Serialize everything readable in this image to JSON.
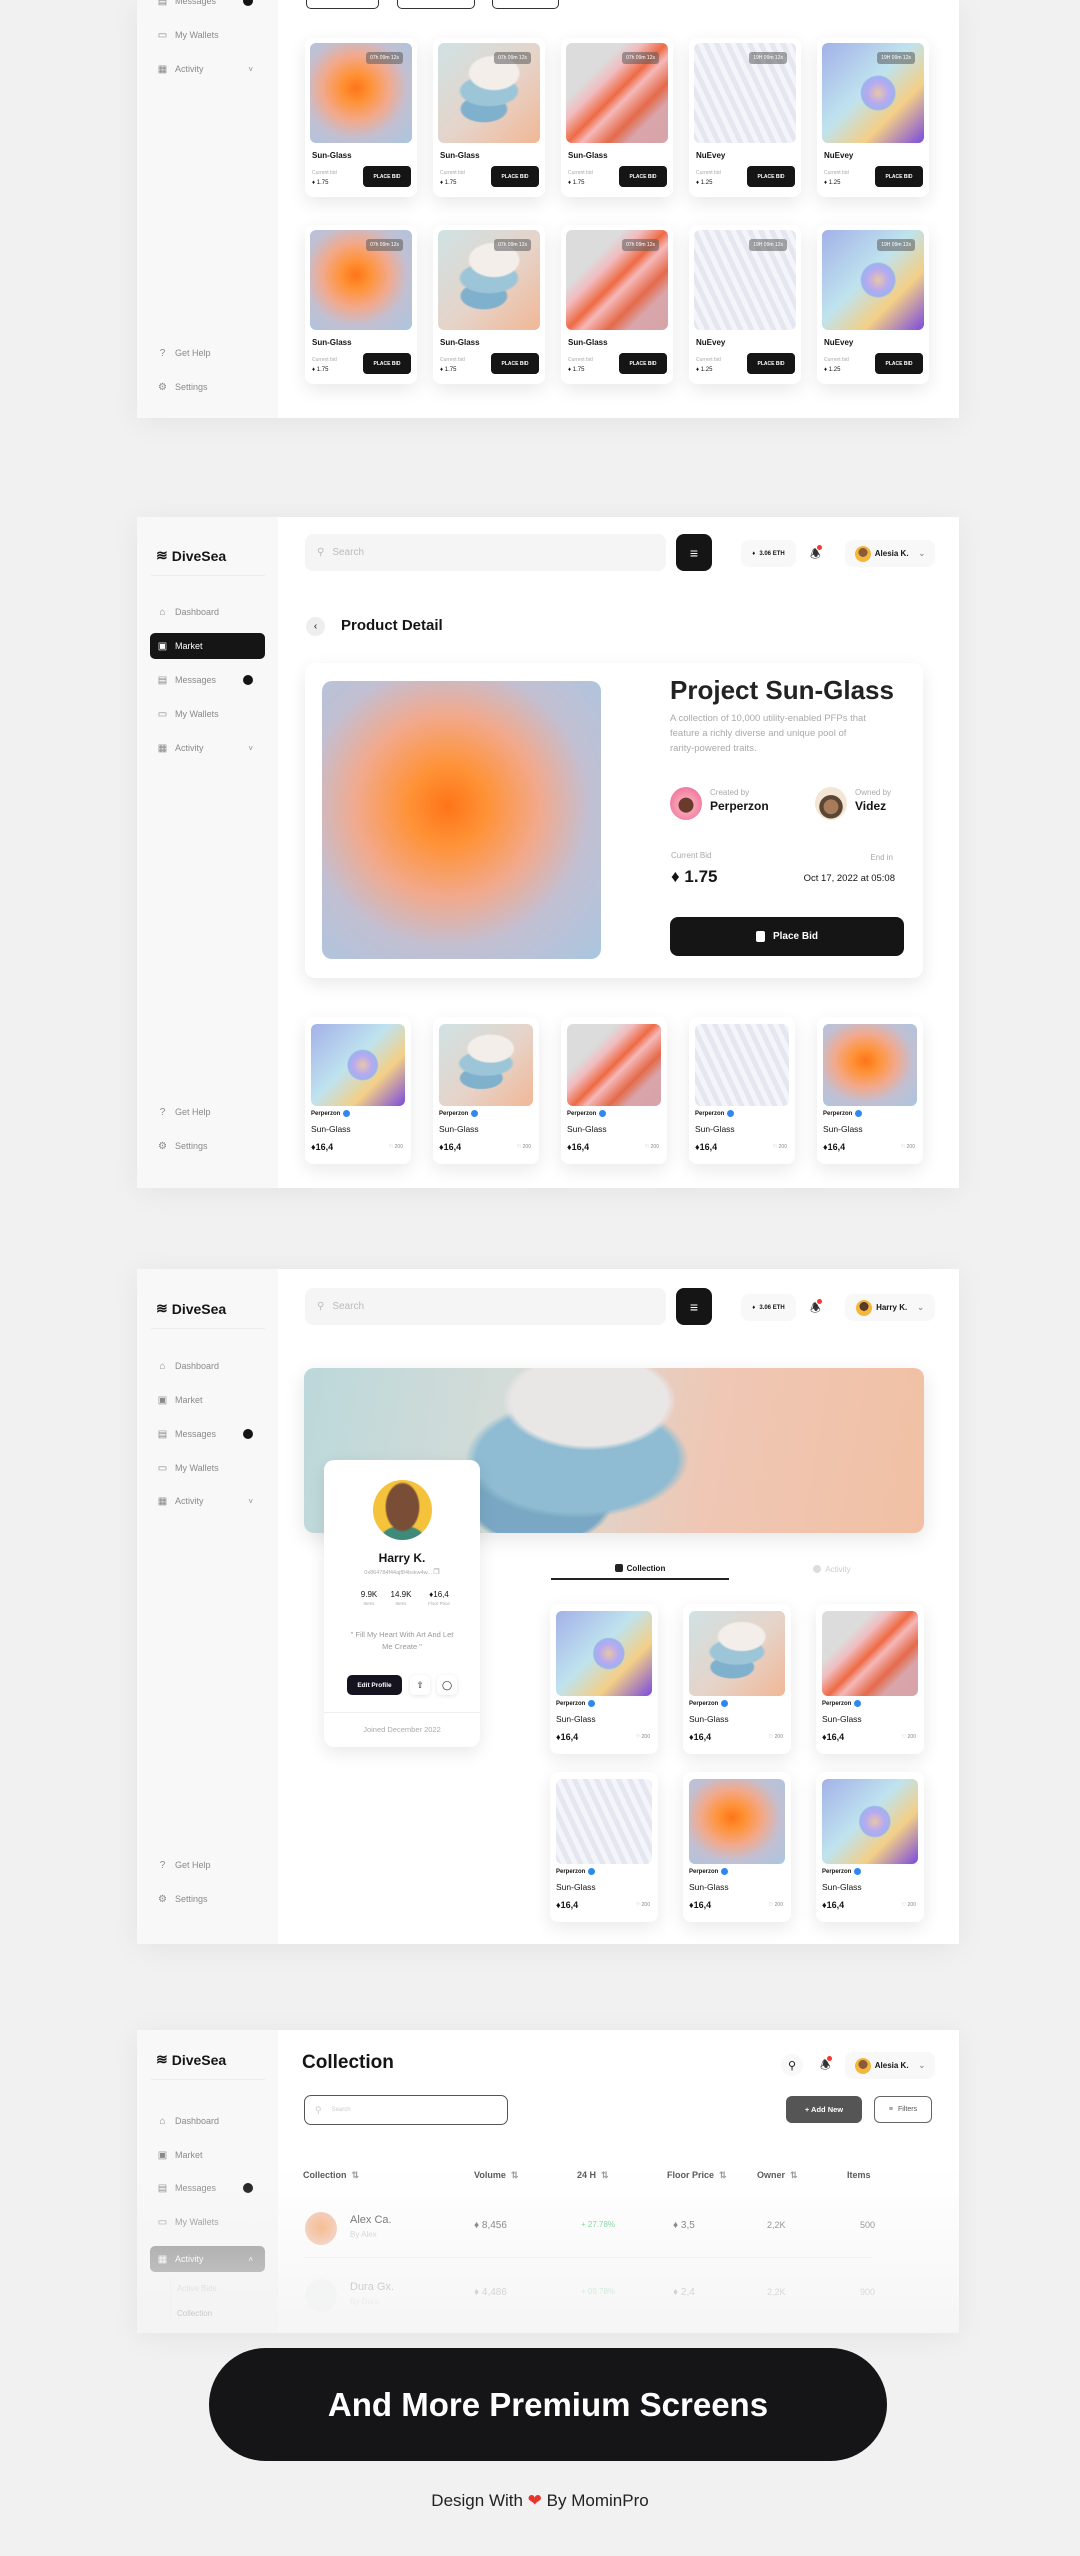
{
  "brand": "DiveSea",
  "colors": {
    "accent": "#151515",
    "verified": "#2e88f0",
    "positive": "#5fd08a",
    "notification": "#ff3333"
  },
  "panel1": {
    "sidebar": [
      {
        "label": "Messages",
        "icon": "messages-icon",
        "badge": true
      },
      {
        "label": "My Wallets",
        "icon": "wallet-icon"
      },
      {
        "label": "Activity",
        "icon": "activity-icon",
        "chevron": true
      }
    ],
    "sidebar_footer": [
      {
        "label": "Get Help",
        "icon": "help-icon"
      },
      {
        "label": "Settings",
        "icon": "settings-icon"
      }
    ],
    "cards": [
      {
        "timer": "07h 09m 12s",
        "name": "Sun-Glass",
        "bid_label": "Current bid",
        "bid": "1.75",
        "button": "PLACE BID",
        "art": "orange"
      },
      {
        "timer": "07h 09m 12s",
        "name": "Sun-Glass",
        "bid_label": "Current bid",
        "bid": "1.75",
        "button": "PLACE BID",
        "art": "disc"
      },
      {
        "timer": "07h 09m 12s",
        "name": "Sun-Glass",
        "bid_label": "Current bid",
        "bid": "1.75",
        "button": "PLACE BID",
        "art": "red"
      },
      {
        "timer": "19H 09m 12s",
        "name": "NuEvey",
        "bid_label": "Current bid",
        "bid": "1.25",
        "button": "PLACE BID",
        "art": "white"
      },
      {
        "timer": "19H 09m 12s",
        "name": "NuEvey",
        "bid_label": "Current bid",
        "bid": "1.25",
        "button": "PLACE BID",
        "art": "planet"
      },
      {
        "timer": "07h 09m 12s",
        "name": "Sun-Glass",
        "bid_label": "Current bid",
        "bid": "1.75",
        "button": "PLACE BID",
        "art": "orange"
      },
      {
        "timer": "07h 09m 12s",
        "name": "Sun-Glass",
        "bid_label": "Current bid",
        "bid": "1.75",
        "button": "PLACE BID",
        "art": "disc"
      },
      {
        "timer": "07h 09m 12s",
        "name": "Sun-Glass",
        "bid_label": "Current bid",
        "bid": "1.75",
        "button": "PLACE BID",
        "art": "red"
      },
      {
        "timer": "19H 09m 12s",
        "name": "NuEvey",
        "bid_label": "Current bid",
        "bid": "1.25",
        "button": "PLACE BID",
        "art": "white"
      },
      {
        "timer": "19H 09m 12s",
        "name": "NuEvey",
        "bid_label": "Current bid",
        "bid": "1.25",
        "button": "PLACE BID",
        "art": "planet"
      }
    ]
  },
  "panel2": {
    "search_placeholder": "Search",
    "eth_balance": "3.06 ETH",
    "user": "Alesia K.",
    "sidebar": [
      {
        "label": "Dashboard",
        "icon": "home-icon"
      },
      {
        "label": "Market",
        "icon": "market-icon",
        "active": true
      },
      {
        "label": "Messages",
        "icon": "messages-icon",
        "badge": true
      },
      {
        "label": "My Wallets",
        "icon": "wallet-icon"
      },
      {
        "label": "Activity",
        "icon": "activity-icon",
        "chevron": true
      }
    ],
    "sidebar_footer": [
      {
        "label": "Get Help",
        "icon": "help-icon"
      },
      {
        "label": "Settings",
        "icon": "settings-icon"
      }
    ],
    "page_title": "Product Detail",
    "product": {
      "title": "Project Sun-Glass",
      "description": "A collection of 10,000 utility-enabled PFPs that feature a richly diverse and unique pool of rarity-powered traits.",
      "created_label": "Created by",
      "creator": "Perperzon",
      "owned_label": "Owned by",
      "owner": "Videz",
      "bid_label": "Current Bid",
      "bid": "1.75",
      "end_label": "End in",
      "end_date": "Oct 17, 2022 at 05:08",
      "button": "Place Bid"
    },
    "cards": [
      {
        "author": "Perperzon",
        "name": "Sun-Glass",
        "price": "16,4",
        "likes": "200",
        "art": "planet"
      },
      {
        "author": "Perperzon",
        "name": "Sun-Glass",
        "price": "16,4",
        "likes": "200",
        "art": "disc"
      },
      {
        "author": "Perperzon",
        "name": "Sun-Glass",
        "price": "16,4",
        "likes": "200",
        "art": "red"
      },
      {
        "author": "Perperzon",
        "name": "Sun-Glass",
        "price": "16,4",
        "likes": "200",
        "art": "white"
      },
      {
        "author": "Perperzon",
        "name": "Sun-Glass",
        "price": "16,4",
        "likes": "200",
        "art": "orange"
      }
    ]
  },
  "panel3": {
    "search_placeholder": "Search",
    "eth_balance": "3.06 ETH",
    "user": "Harry K.",
    "sidebar": [
      {
        "label": "Dashboard",
        "icon": "home-icon"
      },
      {
        "label": "Market",
        "icon": "market-icon"
      },
      {
        "label": "Messages",
        "icon": "messages-icon",
        "badge": true
      },
      {
        "label": "My Wallets",
        "icon": "wallet-icon"
      },
      {
        "label": "Activity",
        "icon": "activity-icon",
        "chevron": true
      }
    ],
    "sidebar_footer": [
      {
        "label": "Get Help",
        "icon": "help-icon"
      },
      {
        "label": "Settings",
        "icon": "settings-icon"
      }
    ],
    "profile": {
      "name": "Harry K.",
      "address": "0x864784f44ajf84bskw4w...",
      "stats": [
        {
          "value": "9.9K",
          "label": "Items"
        },
        {
          "value": "14.9K",
          "label": "Items"
        },
        {
          "value": "16,4",
          "label": "Floor Price"
        }
      ],
      "quote": "\" Fill My Heart With Art And Let Me Create \"",
      "edit_button": "Edit Profile",
      "joined": "Joined December  2022"
    },
    "tabs": [
      {
        "label": "Collection",
        "active": true
      },
      {
        "label": "Activity"
      }
    ],
    "cards": [
      {
        "author": "Perperzon",
        "name": "Sun-Glass",
        "price": "16,4",
        "likes": "200",
        "art": "planet"
      },
      {
        "author": "Perperzon",
        "name": "Sun-Glass",
        "price": "16,4",
        "likes": "200",
        "art": "disc"
      },
      {
        "author": "Perperzon",
        "name": "Sun-Glass",
        "price": "16,4",
        "likes": "200",
        "art": "red"
      },
      {
        "author": "Perperzon",
        "name": "Sun-Glass",
        "price": "16,4",
        "likes": "200",
        "art": "white"
      },
      {
        "author": "Perperzon",
        "name": "Sun-Glass",
        "price": "16,4",
        "likes": "200",
        "art": "orange"
      },
      {
        "author": "Perperzon",
        "name": "Sun-Glass",
        "price": "16,4",
        "likes": "200",
        "art": "planet"
      }
    ]
  },
  "panel4": {
    "title": "Collection",
    "user": "Alesia K.",
    "search_placeholder": "Search",
    "add_button": "+ Add New",
    "filters_button": "Filters",
    "sidebar": [
      {
        "label": "Dashboard",
        "icon": "home-icon"
      },
      {
        "label": "Market",
        "icon": "market-icon"
      },
      {
        "label": "Messages",
        "icon": "messages-icon",
        "badge": true
      },
      {
        "label": "My Wallets",
        "icon": "wallet-icon"
      },
      {
        "label": "Activity",
        "icon": "activity-icon",
        "chevron": true,
        "active": true
      }
    ],
    "sub_items": [
      "Active Bids",
      "Collection"
    ],
    "columns": [
      "Collection",
      "Volume",
      "24 H",
      "Floor Price",
      "Owner",
      "Items"
    ],
    "rows": [
      {
        "name": "Alex Ca.",
        "by": "By Alex",
        "volume": "8,456",
        "change": "+ 27.78%",
        "floor": "3,5",
        "owner": "2,2K",
        "items": "500"
      },
      {
        "name": "Dura Gx.",
        "by": "By Dura",
        "volume": "4,486",
        "change": "+ 09.78%",
        "floor": "2,4",
        "owner": "2,2K",
        "items": "900"
      }
    ]
  },
  "promo": {
    "label": "And More Premium Screens"
  },
  "footer": {
    "before": "Design With",
    "after": "By MominPro"
  }
}
